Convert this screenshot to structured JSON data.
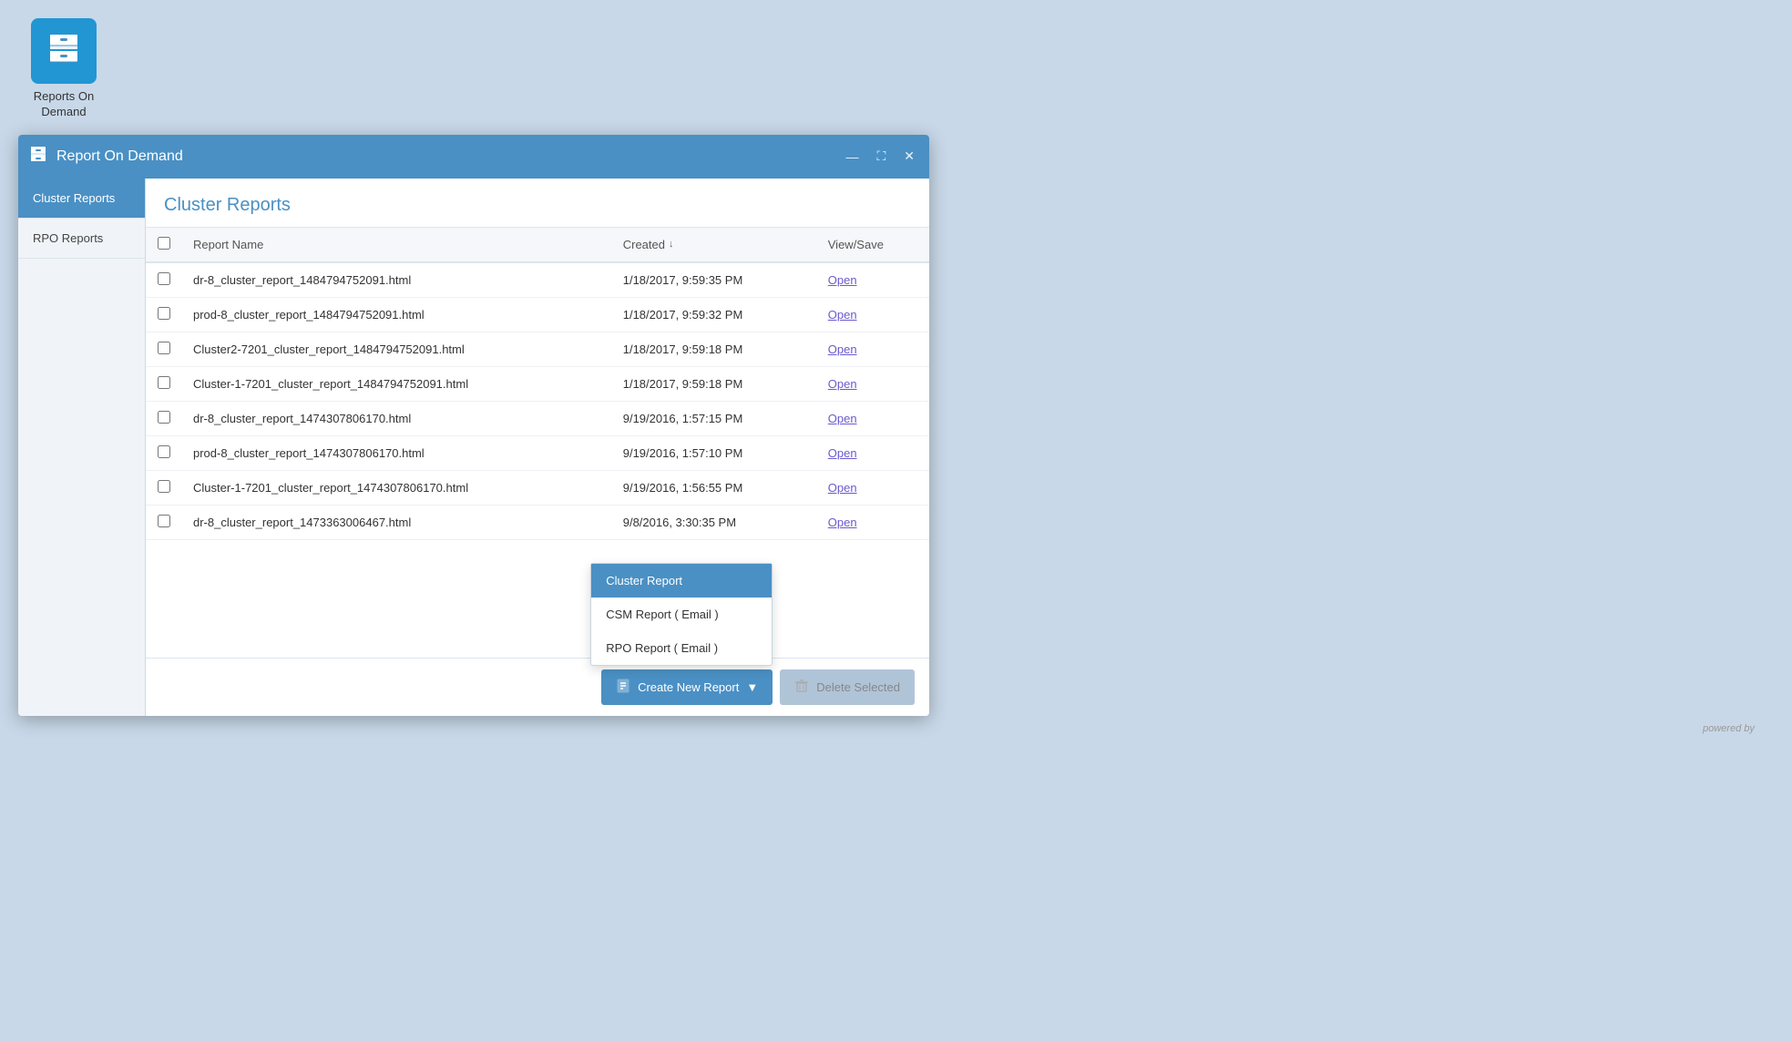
{
  "app": {
    "icon_char": "🗂",
    "title_line1": "Reports On",
    "title_line2": "Demand"
  },
  "window": {
    "title": "Report On Demand",
    "icon_char": "🗂"
  },
  "sidebar": {
    "items": [
      {
        "id": "cluster-reports",
        "label": "Cluster Reports",
        "active": true
      },
      {
        "id": "rpo-reports",
        "label": "RPO Reports",
        "active": false
      }
    ]
  },
  "content": {
    "heading": "Cluster Reports",
    "table": {
      "columns": [
        {
          "id": "select",
          "label": ""
        },
        {
          "id": "report-name",
          "label": "Report Name"
        },
        {
          "id": "created",
          "label": "Created"
        },
        {
          "id": "view-save",
          "label": "View/Save"
        }
      ],
      "rows": [
        {
          "name": "dr-8_cluster_report_1484794752091.html",
          "created": "1/18/2017, 9:59:35 PM",
          "link": "Open"
        },
        {
          "name": "prod-8_cluster_report_1484794752091.html",
          "created": "1/18/2017, 9:59:32 PM",
          "link": "Open"
        },
        {
          "name": "Cluster2-7201_cluster_report_1484794752091.html",
          "created": "1/18/2017, 9:59:18 PM",
          "link": "Open"
        },
        {
          "name": "Cluster-1-7201_cluster_report_1484794752091.html",
          "created": "1/18/2017, 9:59:18 PM",
          "link": "Open"
        },
        {
          "name": "dr-8_cluster_report_1474307806170.html",
          "created": "9/19/2016, 1:57:15 PM",
          "link": "Open"
        },
        {
          "name": "prod-8_cluster_report_1474307806170.html",
          "created": "9/19/2016, 1:57:10 PM",
          "link": "Open"
        },
        {
          "name": "Cluster-1-7201_cluster_report_1474307806170.html",
          "created": "9/19/2016, 1:56:55 PM",
          "link": "Open"
        },
        {
          "name": "dr-8_cluster_report_1473363006467.html",
          "created": "9/8/2016, 3:30:35 PM",
          "link": "Open"
        }
      ]
    }
  },
  "footer": {
    "create_button_label": "Create New Report",
    "create_button_icon": "📄",
    "delete_button_label": "Delete Selected",
    "delete_button_icon": "🗑"
  },
  "dropdown": {
    "items": [
      {
        "id": "cluster-report",
        "label": "Cluster Report",
        "highlighted": true
      },
      {
        "id": "csm-report",
        "label": "CSM Report ( Email )",
        "highlighted": false
      },
      {
        "id": "rpo-report",
        "label": "RPO Report ( Email )",
        "highlighted": false
      }
    ]
  },
  "powered_by": "powered by"
}
